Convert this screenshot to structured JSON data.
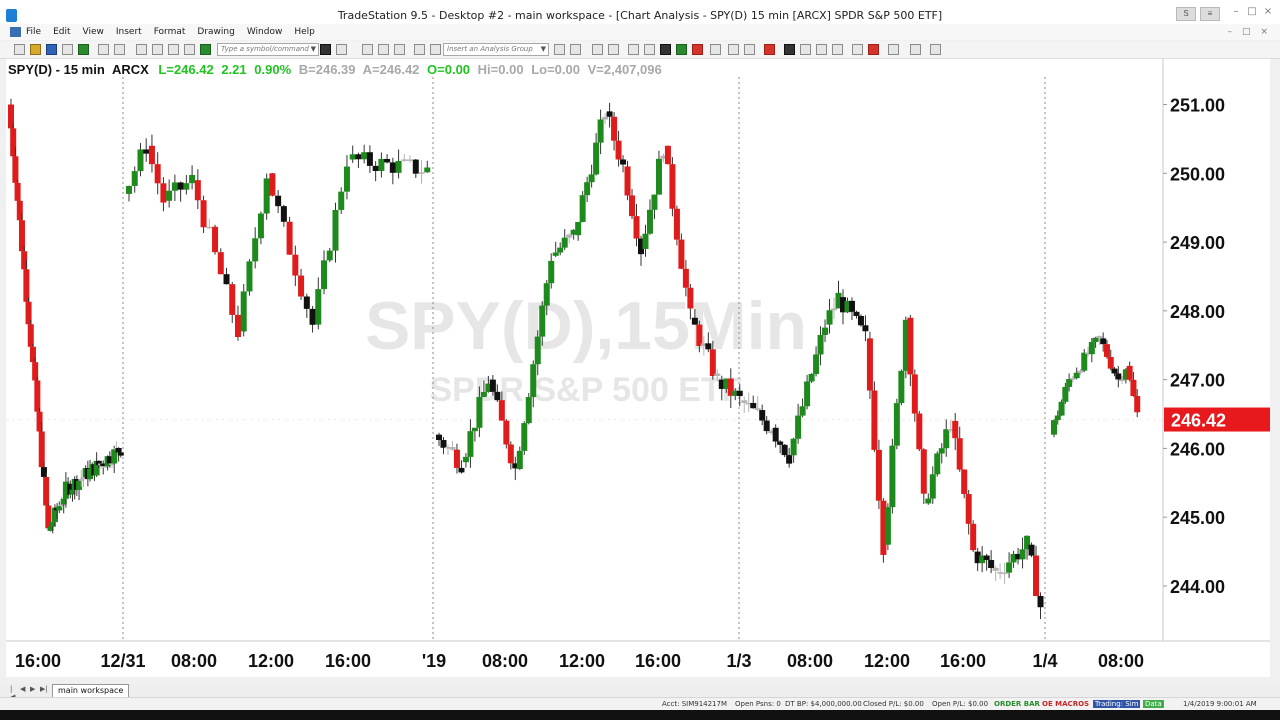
{
  "window": {
    "title": "TradeStation 9.5 - Desktop #2 - main workspace - [Chart Analysis - SPY(D) 15 min [ARCX] SPDR S&P 500 ETF]",
    "buttons": [
      "–",
      "□",
      "×"
    ]
  },
  "menu": {
    "items": [
      "File",
      "Edit",
      "View",
      "Insert",
      "Format",
      "Drawing",
      "Window",
      "Help"
    ],
    "mdi": [
      "–",
      "□",
      "×"
    ]
  },
  "toolbar": {
    "symbol_placeholder": "Type a symbol/command",
    "analysis_group_placeholder": "Insert an Analysis Group"
  },
  "chart_info": {
    "symbol": "SPY(D) - 15 min",
    "exchange": "ARCX",
    "last": "L=246.42",
    "change": "2.21",
    "percent": "0.90%",
    "bid": "B=246.39",
    "ask": "A=246.42",
    "open": "O=0.00",
    "high": "Hi=0.00",
    "low": "Lo=0.00",
    "volume": "V=2,407,096"
  },
  "watermark": {
    "line1": "SPY(D),15Min",
    "line2": "SPDR S&P 500 ETF"
  },
  "chart_data": {
    "type": "candlestick",
    "title": "SPY(D) - 15 min",
    "ylim": [
      243.2,
      251.4
    ],
    "y_ticks": [
      "251.00",
      "250.00",
      "249.00",
      "248.00",
      "247.00",
      "246.00",
      "245.00",
      "244.00"
    ],
    "x_ticks": [
      "16:00",
      "12/31",
      "08:00",
      "12:00",
      "16:00",
      "'19",
      "08:00",
      "12:00",
      "16:00",
      "1/3",
      "08:00",
      "12:00",
      "16:00",
      "1/4",
      "08:00"
    ],
    "last_price_label": "246.42",
    "last_price": 246.42,
    "grid": "day separators only",
    "segments": [
      {
        "start": 251.0,
        "pts": [
          [
            18,
            244.8
          ],
          [
            8,
            245.4
          ],
          [
            25,
            246.0
          ]
        ],
        "vol": 0.25
      },
      {
        "start": 249.7,
        "pts": [
          [
            4,
            250.4
          ],
          [
            3,
            249.6
          ],
          [
            5,
            249.9
          ],
          [
            8,
            247.7
          ],
          [
            5,
            250.0
          ],
          [
            8,
            247.8
          ],
          [
            6,
            250.2
          ],
          [
            14,
            250.05
          ]
        ],
        "vol": 0.3
      },
      {
        "start": 246.2,
        "pts": [
          [
            6,
            245.8
          ],
          [
            6,
            247.0
          ],
          [
            6,
            245.7
          ],
          [
            8,
            248.8
          ],
          [
            5,
            249.1
          ],
          [
            7,
            250.9
          ],
          [
            4,
            250.1
          ],
          [
            4,
            248.9
          ],
          [
            5,
            250.4
          ],
          [
            6,
            247.9
          ],
          [
            6,
            247.0
          ],
          [
            5,
            246.7
          ],
          [
            7,
            246.3
          ],
          [
            4,
            245.9
          ],
          [
            8,
            247.8
          ],
          [
            3,
            248.2
          ],
          [
            6,
            247.6
          ],
          [
            4,
            244.6
          ],
          [
            5,
            247.9
          ],
          [
            4,
            245.2
          ],
          [
            6,
            246.4
          ],
          [
            5,
            244.5
          ],
          [
            5,
            244.2
          ],
          [
            7,
            244.6
          ],
          [
            3,
            243.7
          ]
        ],
        "vol": 0.3
      },
      {
        "start": 246.2,
        "pts": [
          [
            5,
            247.0
          ],
          [
            8,
            247.6
          ],
          [
            5,
            247.0
          ],
          [
            2,
            247.2
          ],
          [
            3,
            246.5
          ]
        ],
        "vol": 0.2
      }
    ]
  },
  "sheet_tab": "main workspace",
  "status": {
    "account": "Acct: SIM914217M",
    "open_posns": "Open Psns: 0",
    "dt_bp": "DT BP: $4,000,000.00",
    "closed_pl": "Closed P/L: $0.00",
    "open_pl": "Open P/L: $0.00",
    "order_bar": "ORDER BAR",
    "oe_macros": "OE MACROS",
    "trading": "Trading: Sim",
    "data": "Data",
    "datetime": "1/4/2019 9:00:01 AM"
  }
}
